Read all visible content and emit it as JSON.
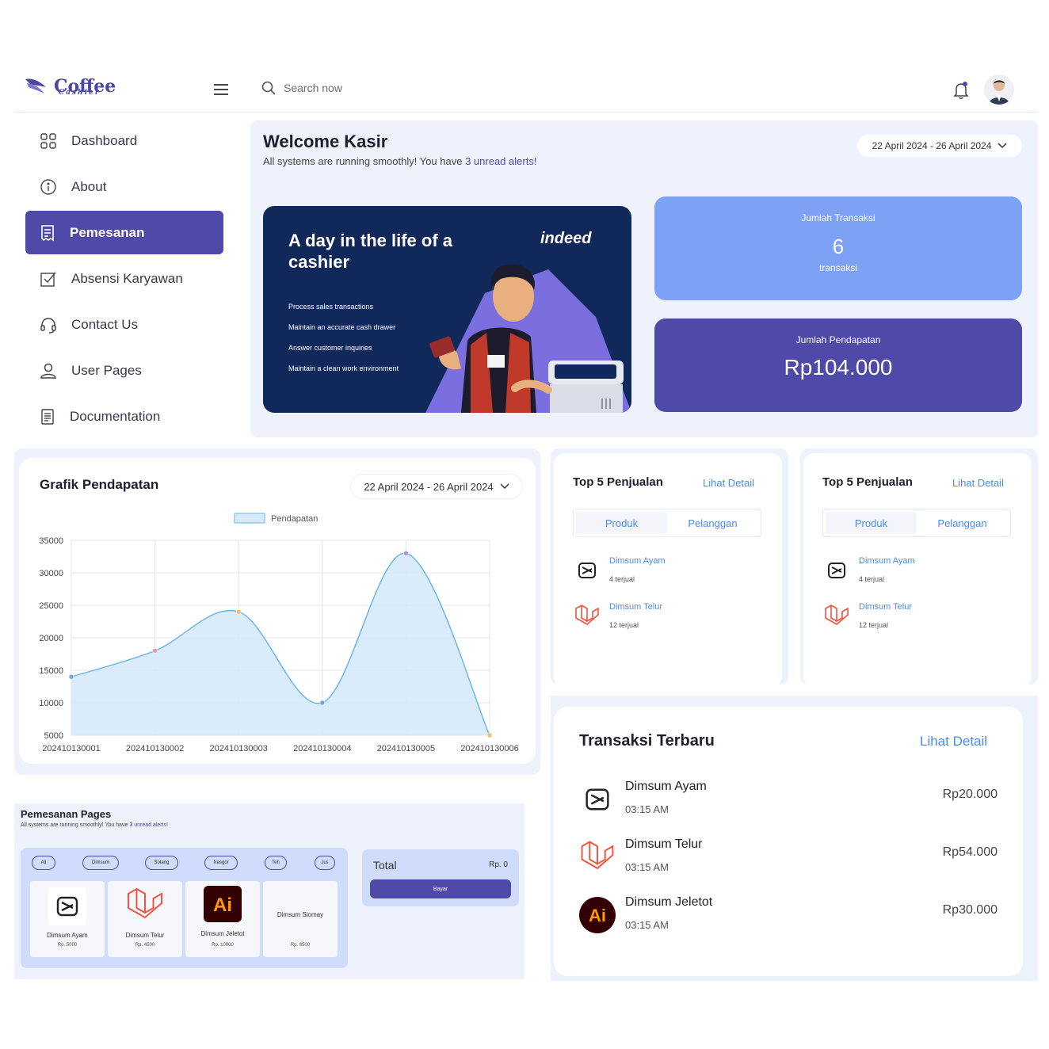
{
  "header": {
    "logo_text": "Coffee",
    "logo_sub": "Cashier",
    "search_placeholder": "Search now"
  },
  "sidebar": {
    "items": [
      {
        "label": "Dashboard",
        "icon": "grid-icon"
      },
      {
        "label": "About",
        "icon": "info-icon"
      },
      {
        "label": "Pemesanan",
        "icon": "receipt-icon",
        "active": true
      },
      {
        "label": "Absensi Karyawan",
        "icon": "checkbox-icon"
      },
      {
        "label": "Contact Us",
        "icon": "headset-icon"
      },
      {
        "label": "User Pages",
        "icon": "user-icon"
      },
      {
        "label": "Documentation",
        "icon": "document-icon"
      }
    ]
  },
  "welcome": {
    "title": "Welcome Kasir",
    "subtitle_prefix": "All systems are running smoothly! You have ",
    "subtitle_link": "3 unread alerts!",
    "date_range": "22 April 2024 - 26 April 2024"
  },
  "banner": {
    "title": "A day in the life of a cashier",
    "brand": "indeed",
    "items": [
      "Process sales transactions",
      "Maintain an accurate cash drawer",
      "Answer customer inquiries",
      "Maintain a clean work environment"
    ]
  },
  "stats": {
    "transaksi_label": "Jumlah Transaksi",
    "transaksi_value": "6",
    "transaksi_unit": "transaksi",
    "pendapatan_label": "Jumlah Pendapatan",
    "pendapatan_value": "Rp104.000"
  },
  "chart_section": {
    "title": "Grafik Pendapatan",
    "date_range": "22 April 2024 - 26 April 2024"
  },
  "chart_data": {
    "type": "area",
    "x": [
      "202410130001",
      "202410130002",
      "202410130003",
      "202410130004",
      "202410130005",
      "202410130006"
    ],
    "series": [
      {
        "name": "Pendapatan",
        "values": [
          14000,
          18000,
          24000,
          10000,
          33000,
          5000
        ],
        "point_colors": [
          "#7aa6e8",
          "#e89aa6",
          "#f0c070",
          "#7aa6e8",
          "#a09ae8",
          "#f0c070"
        ]
      }
    ],
    "yticks": [
      5000,
      10000,
      15000,
      20000,
      25000,
      30000,
      35000
    ],
    "ylim": [
      5000,
      35000
    ],
    "grid": true,
    "legend": "top-center",
    "colors": {
      "line": "#6cb7e8",
      "fill": "#d6e9f8"
    }
  },
  "top5": [
    {
      "title": "Top 5 Penjualan",
      "link": "Lihat Detail",
      "tabs": [
        "Produk",
        "Pelanggan"
      ],
      "items": [
        {
          "name": "Dimsum Ayam",
          "sold": "4 terjual",
          "icon": "capcut-icon"
        },
        {
          "name": "Dimsum Telur",
          "sold": "12 terjual",
          "icon": "laravel-icon"
        }
      ]
    },
    {
      "title": "Top 5 Penjualan",
      "link": "Lihat Detail",
      "tabs": [
        "Produk",
        "Pelanggan"
      ],
      "items": [
        {
          "name": "Dimsum Ayam",
          "sold": "4 terjual",
          "icon": "capcut-icon"
        },
        {
          "name": "Dimsum Telur",
          "sold": "12 terjual",
          "icon": "laravel-icon"
        }
      ]
    }
  ],
  "transaksi": {
    "title": "Transaksi Terbaru",
    "link": "Lihat Detail",
    "rows": [
      {
        "name": "Dimsum Ayam",
        "time": "03:15 AM",
        "price": "Rp20.000",
        "icon": "capcut-icon"
      },
      {
        "name": "Dimsum Telur",
        "time": "03:15 AM",
        "price": "Rp54.000",
        "icon": "laravel-icon"
      },
      {
        "name": "Dimsum Jeletot",
        "time": "03:15 AM",
        "price": "Rp30.000",
        "icon": "illustrator-icon"
      }
    ]
  },
  "pemesanan": {
    "title": "Pemesanan Pages",
    "subtitle_prefix": "All systems are running smoothly! You have ",
    "subtitle_link": "3 unread alerts!",
    "chips": [
      "All",
      "Dimsum",
      "Sotang",
      "Nasgor",
      "Teh",
      "Jus"
    ],
    "products": [
      {
        "name": "Dimsum Ayam",
        "price": "Rp. 5000",
        "icon": "capcut-icon"
      },
      {
        "name": "Dimsum Telur",
        "price": "Rp. 4500",
        "icon": "laravel-icon"
      },
      {
        "name": "Dimsum Jeletot",
        "price": "Rp. 10000",
        "icon": "illustrator-icon"
      },
      {
        "name": "Dimsum Siomay",
        "price": "Rp. 8500",
        "icon": ""
      }
    ],
    "total_label": "Total",
    "total_value": "Rp. 0",
    "pay_button": "Bayar"
  }
}
